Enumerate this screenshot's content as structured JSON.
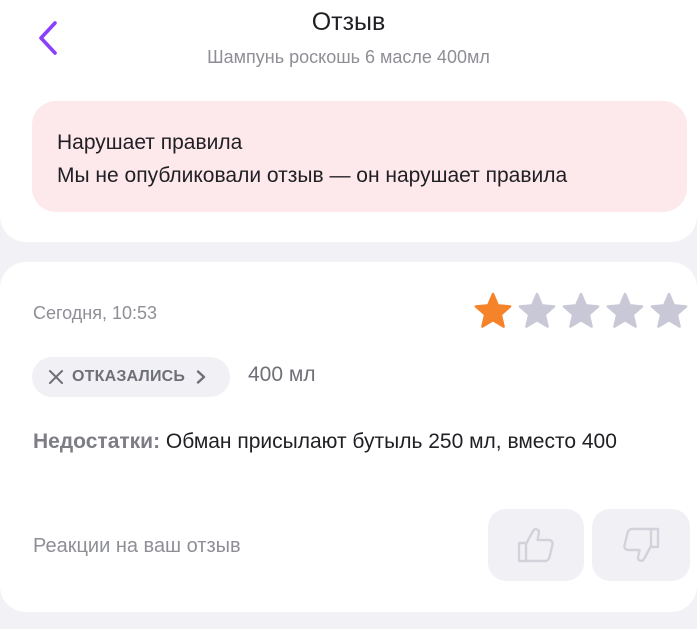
{
  "header": {
    "title": "Отзыв",
    "subtitle": "Шампунь роскошь 6 масле 400мл",
    "back_icon": "chevron-left-icon"
  },
  "alert": {
    "title": "Нарушает правила",
    "text": "Мы не опубликовали отзыв — он нарушает правила",
    "background": "#fde8ec"
  },
  "review": {
    "date": "Сегодня, 10:53",
    "rating": 1,
    "rating_max": 5,
    "star_active_color": "#f5832a",
    "star_inactive_color": "#c9c8d6",
    "status_chip": {
      "label": "ОТКАЗАЛИСЬ",
      "icon": "close-icon",
      "chevron": "chevron-right-icon"
    },
    "variant": "400 мл",
    "cons_label": "Недостатки:",
    "cons_text": " Обман присылают бутыль 250 мл, вместо 400",
    "reactions_label": "Реакции на ваш отзыв",
    "like_icon": "thumbs-up-icon",
    "dislike_icon": "thumbs-down-icon"
  },
  "colors": {
    "accent": "#8a3ffc",
    "background": "#f2f2f6"
  }
}
